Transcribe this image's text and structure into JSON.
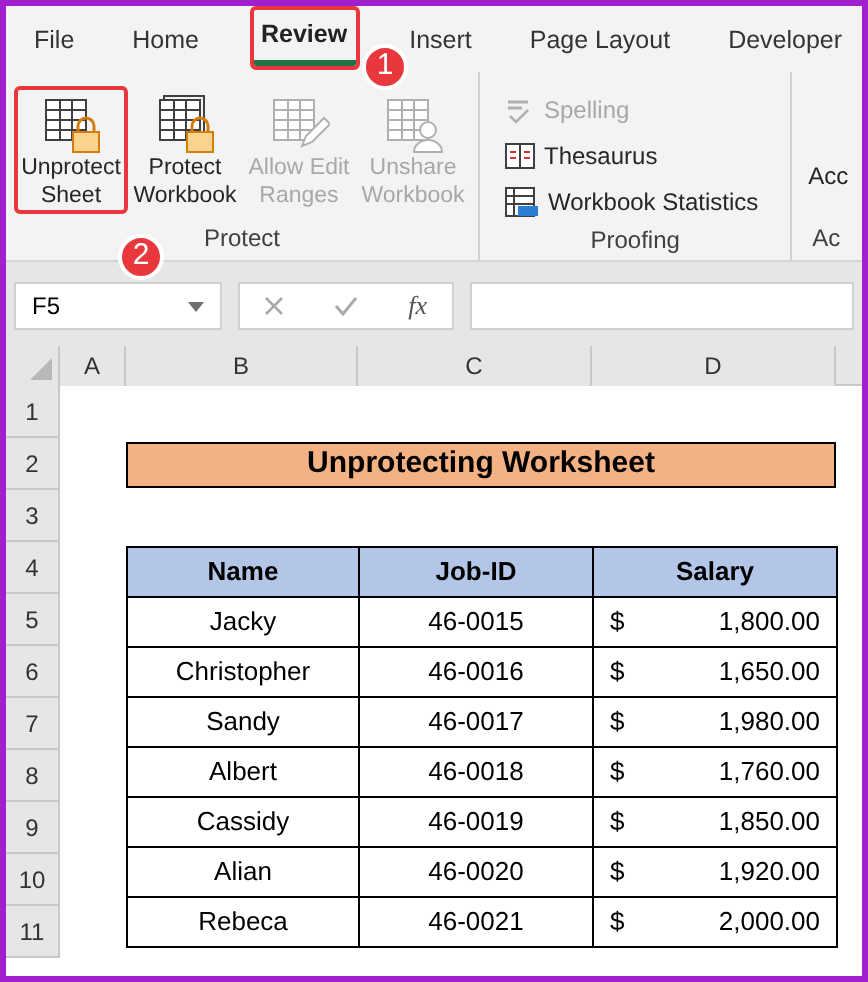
{
  "tabs": [
    {
      "label": "File",
      "selected": false
    },
    {
      "label": "Home",
      "selected": false
    },
    {
      "label": "Review",
      "selected": true
    },
    {
      "label": "Insert",
      "selected": false
    },
    {
      "label": "Page Layout",
      "selected": false
    },
    {
      "label": "Developer",
      "selected": false
    }
  ],
  "ribbon_groups": [
    {
      "label": "Protect",
      "kind": "large",
      "buttons": [
        {
          "label": "Unprotect Sheet",
          "disabled": false,
          "highlighted": true
        },
        {
          "label": "Protect Workbook",
          "disabled": false,
          "highlighted": false
        },
        {
          "label": "Allow Edit Ranges",
          "disabled": true,
          "highlighted": false
        },
        {
          "label": "Unshare Workbook",
          "disabled": true,
          "highlighted": false
        }
      ]
    },
    {
      "label": "Proofing",
      "kind": "small",
      "buttons": [
        {
          "label": "Spelling",
          "disabled": true
        },
        {
          "label": "Thesaurus",
          "disabled": false
        },
        {
          "label": "Workbook Statistics",
          "disabled": false
        }
      ]
    },
    {
      "label": "Ac",
      "kind": "cut",
      "buttons": [
        {
          "label": "Acc"
        }
      ]
    }
  ],
  "annotations": [
    "1",
    "2"
  ],
  "formula_bar": {
    "name_box": "F5",
    "function_label": "fx"
  },
  "columns": [
    "A",
    "B",
    "C",
    "D"
  ],
  "row_numbers": [
    "1",
    "2",
    "3",
    "4",
    "5",
    "6",
    "7",
    "8",
    "9",
    "10",
    "11"
  ],
  "sheet": {
    "title": "Unprotecting Worksheet",
    "headers": [
      "Name",
      "Job-ID",
      "Salary"
    ],
    "rows": [
      {
        "name": "Jacky",
        "job_id": "46-0015",
        "currency": "$",
        "salary": "1,800.00"
      },
      {
        "name": "Christopher",
        "job_id": "46-0016",
        "currency": "$",
        "salary": "1,650.00"
      },
      {
        "name": "Sandy",
        "job_id": "46-0017",
        "currency": "$",
        "salary": "1,980.00"
      },
      {
        "name": "Albert",
        "job_id": "46-0018",
        "currency": "$",
        "salary": "1,760.00"
      },
      {
        "name": "Cassidy",
        "job_id": "46-0019",
        "currency": "$",
        "salary": "1,850.00"
      },
      {
        "name": "Alian",
        "job_id": "46-0020",
        "currency": "$",
        "salary": "1,920.00"
      },
      {
        "name": "Rebeca",
        "job_id": "46-0021",
        "currency": "$",
        "salary": "2,000.00"
      }
    ]
  }
}
